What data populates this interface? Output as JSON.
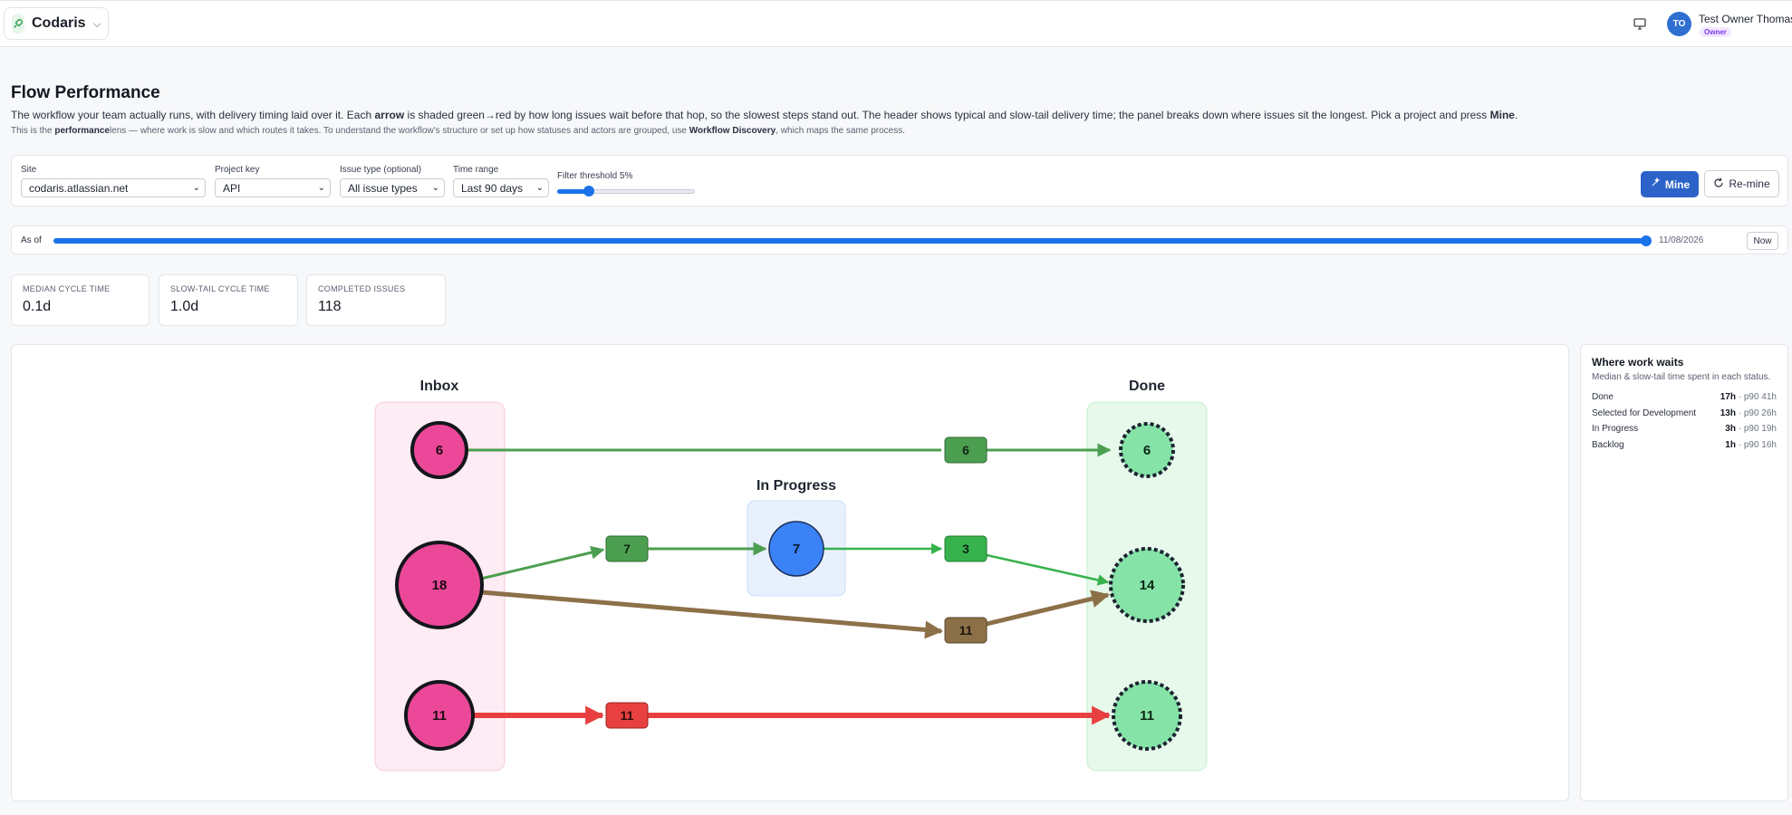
{
  "app": {
    "name": "Codaris",
    "user_name": "Test Owner Thomas",
    "user_initials": "TO",
    "user_role": "Owner"
  },
  "page": {
    "title": "Flow Performance",
    "desc_1": "The workflow your team actually runs, with delivery timing laid over it. Each ",
    "desc_bold_1": "arrow",
    "desc_2": " is shaded green→red by how long issues wait before that hop, so the slowest steps stand out. The header shows typical and slow-tail delivery time; the panel breaks  down where issues sit the longest. Pick a project and press ",
    "desc_bold_2": "Mine",
    "desc_3": ".",
    "sub_1": "This is the ",
    "sub_bold_1": "performance",
    "sub_2": "lens — where work is slow and which routes it takes. To understand the workflow's structure or set up how statuses and actors are grouped, use ",
    "sub_bold_2": "Workflow Discovery",
    "sub_3": ", which maps the same process."
  },
  "filters": {
    "site_label": "Site",
    "site_value": "codaris.atlassian.net",
    "project_label": "Project key",
    "project_value": "API",
    "issue_type_label": "Issue type (optional)",
    "issue_type_value": "All issue types",
    "time_range_label": "Time range",
    "time_range_value": "Last 90 days",
    "threshold_label": "Filter threshold 5%",
    "threshold_value": 0.23,
    "mine_label": "Mine",
    "remine_label": "Re-mine"
  },
  "asof": {
    "label": "As of",
    "date": "11/08/2026",
    "now_label": "Now"
  },
  "stats": [
    {
      "label": "MEDIAN CYCLE TIME",
      "value": "0.1d"
    },
    {
      "label": "SLOW-TAIL CYCLE TIME",
      "value": "1.0d"
    },
    {
      "label": "COMPLETED ISSUES",
      "value": "118"
    }
  ],
  "flow": {
    "lanes": {
      "inbox": "Inbox",
      "in_progress": "In Progress",
      "done": "Done"
    },
    "inbox_nodes": [
      "6",
      "18",
      "11"
    ],
    "in_progress_node": "7",
    "done_nodes": [
      "6",
      "14",
      "11"
    ],
    "edge_labels": {
      "top": "6",
      "mid_a": "7",
      "mid_b": "3",
      "slow": "11",
      "red": "11"
    },
    "colors": {
      "inbox": "#ec4899",
      "in_progress": "#3b82f6",
      "done": "#86e3a8",
      "green": "#4c9f50",
      "bright_green": "#37b24d",
      "brown": "#8c7048",
      "red": "#e84040"
    }
  },
  "waits": {
    "title": "Where work waits",
    "subtitle": "Median & slow-tail time spent in each status.",
    "rows": [
      {
        "status": "Done",
        "median": "17h",
        "p90": "· p90 41h"
      },
      {
        "status": "Selected for Development",
        "median": "13h",
        "p90": "· p90 26h"
      },
      {
        "status": "In Progress",
        "median": "3h",
        "p90": "· p90 19h"
      },
      {
        "status": "Backlog",
        "median": "1h",
        "p90": "· p90 16h"
      }
    ]
  }
}
